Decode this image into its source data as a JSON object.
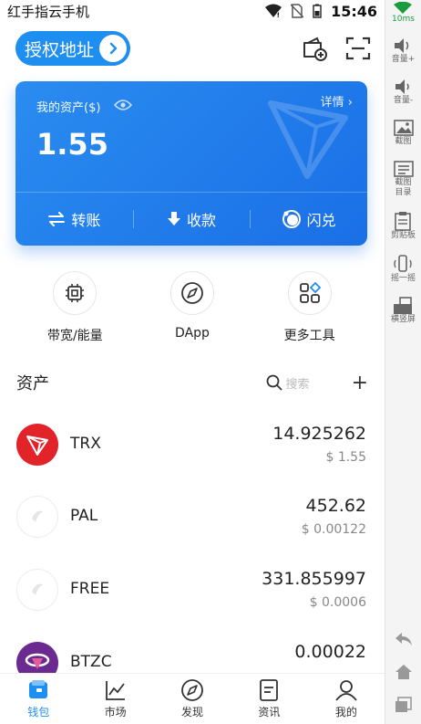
{
  "status_bar": {
    "app_name": "红手指云手机",
    "time": "15:46"
  },
  "sidebar_tools": {
    "ping": "10ms",
    "items": [
      {
        "label": "音量+",
        "icon": "volume-up-icon"
      },
      {
        "label": "音量-",
        "icon": "volume-down-icon"
      },
      {
        "label": "截图",
        "icon": "screenshot-icon"
      },
      {
        "label": "截图目录",
        "icon": "screenshot-folder-icon"
      },
      {
        "label": "剪贴板",
        "icon": "clipboard-icon"
      },
      {
        "label": "摇一摇",
        "icon": "shake-icon"
      },
      {
        "label": "横竖屏",
        "icon": "rotate-icon"
      }
    ]
  },
  "header": {
    "auth_label": "授权地址"
  },
  "card": {
    "assets_label": "我的资产($)",
    "detail_label": "详情 ›",
    "amount": "1.55",
    "actions": [
      {
        "label": "转账",
        "icon": "transfer-icon"
      },
      {
        "label": "收款",
        "icon": "receive-icon"
      },
      {
        "label": "闪兑",
        "icon": "swap-icon"
      }
    ]
  },
  "tools": [
    {
      "label": "带宽/能量",
      "icon": "chip-icon"
    },
    {
      "label": "DApp",
      "icon": "compass-icon"
    },
    {
      "label": "更多工具",
      "icon": "grid-icon"
    }
  ],
  "assets": {
    "title": "资产",
    "search_placeholder": "搜索",
    "add_label": "+"
  },
  "tokens": [
    {
      "symbol": "TRX",
      "balance": "14.925262",
      "value": "$ 1.55"
    },
    {
      "symbol": "PAL",
      "balance": "452.62",
      "value": "$ 0.00122"
    },
    {
      "symbol": "FREE",
      "balance": "331.855997",
      "value": "$ 0.0006"
    },
    {
      "symbol": "BTZC",
      "balance": "0.00022",
      "value": ""
    }
  ],
  "bottom_nav": [
    {
      "label": "钱包",
      "icon": "wallet-icon",
      "active": true
    },
    {
      "label": "市场",
      "icon": "market-icon",
      "active": false
    },
    {
      "label": "发现",
      "icon": "discover-icon",
      "active": false
    },
    {
      "label": "资讯",
      "icon": "news-icon",
      "active": false
    },
    {
      "label": "我的",
      "icon": "profile-icon",
      "active": false
    }
  ],
  "colors": {
    "accent": "#1f8ef1",
    "trx_red": "#e2232a",
    "ping_green": "#1a9c3e"
  }
}
